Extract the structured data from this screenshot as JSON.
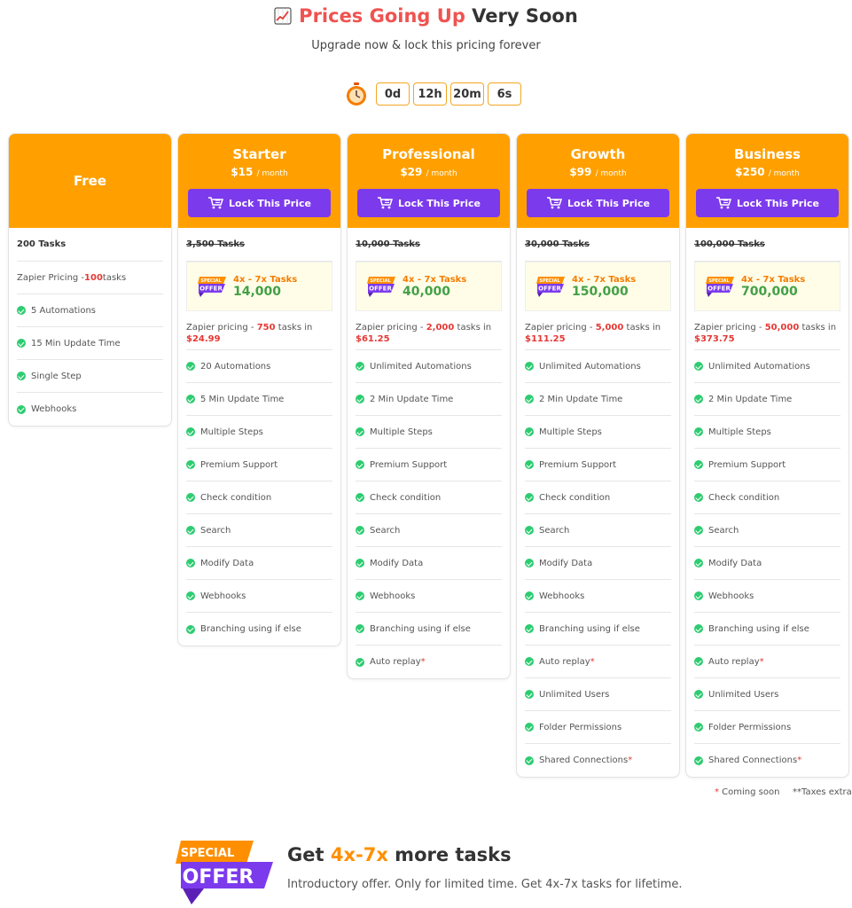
{
  "header": {
    "icon": "chart-increasing-icon",
    "title_accent": "Prices Going Up",
    "title_rest": "Very Soon",
    "subtitle": "Upgrade now & lock this pricing forever"
  },
  "countdown": {
    "icon": "stopwatch-icon",
    "days": "0d",
    "hours": "12h",
    "minutes": "20m",
    "seconds": "6s"
  },
  "colors": {
    "header_orange": "#ffa000",
    "button_purple": "#7c3aed",
    "accent_red": "#ef5350",
    "check_green": "#2ecc71",
    "offer_bg": "#fffde7"
  },
  "plans": {
    "free": {
      "name": "Free",
      "tasks": "200 Tasks",
      "zapier_pre": "Zapier Pricing -",
      "zapier_num": "100",
      "zapier_post": " tasks",
      "features": [
        "5 Automations",
        "15 Min Update Time",
        "Single Step",
        "Webhooks"
      ]
    },
    "starter": {
      "name": "Starter",
      "price": "$15",
      "period": "/ month",
      "button": "Lock This Price",
      "old_tasks": "3,500 Tasks",
      "offer_multi": "4x - 7x Tasks",
      "offer_tasks": "14,000",
      "zapier_pre": "Zapier pricing - ",
      "zapier_num": "750",
      "zapier_post": " tasks in",
      "zapier_price": "$24.99",
      "features": [
        "20 Automations",
        "5 Min Update Time",
        "Multiple Steps",
        "Premium Support",
        "Check condition",
        "Search",
        "Modify Data",
        "Webhooks",
        "Branching using if else"
      ]
    },
    "professional": {
      "name": "Professional",
      "price": "$29",
      "period": "/ month",
      "button": "Lock This Price",
      "old_tasks": "10,000 Tasks",
      "offer_multi": "4x - 7x Tasks",
      "offer_tasks": "40,000",
      "zapier_pre": "Zapier pricing - ",
      "zapier_num": "2,000",
      "zapier_post": " tasks in",
      "zapier_price": "$61.25",
      "features": [
        "Unlimited Automations",
        "2 Min Update Time",
        "Multiple Steps",
        "Premium Support",
        "Check condition",
        "Search",
        "Modify Data",
        "Webhooks",
        "Branching using if else",
        "Auto replay"
      ]
    },
    "growth": {
      "name": "Growth",
      "price": "$99",
      "period": "/ month",
      "button": "Lock This Price",
      "old_tasks": "30,000 Tasks",
      "offer_multi": "4x - 7x Tasks",
      "offer_tasks": "150,000",
      "zapier_pre": "Zapier pricing - ",
      "zapier_num": "5,000",
      "zapier_post": " tasks in",
      "zapier_price": "$111.25",
      "features": [
        "Unlimited Automations",
        "2 Min Update Time",
        "Multiple Steps",
        "Premium Support",
        "Check condition",
        "Search",
        "Modify Data",
        "Webhooks",
        "Branching using if else",
        "Auto replay",
        "Unlimited Users",
        "Folder Permissions",
        "Shared Connections"
      ]
    },
    "business": {
      "name": "Business",
      "price": "$250",
      "period": "/ month",
      "button": "Lock This Price",
      "old_tasks": "100,000 Tasks",
      "offer_multi": "4x - 7x Tasks",
      "offer_tasks": "700,000",
      "zapier_pre": "Zapier pricing - ",
      "zapier_num": "50,000",
      "zapier_post": " tasks in",
      "zapier_price": "$373.75",
      "features": [
        "Unlimited Automations",
        "2 Min Update Time",
        "Multiple Steps",
        "Premium Support",
        "Check condition",
        "Search",
        "Modify Data",
        "Webhooks",
        "Branching using if else",
        "Auto replay",
        "Unlimited Users",
        "Folder Permissions",
        "Shared Connections"
      ]
    }
  },
  "badge": {
    "special": "SPECIAL",
    "offer": "OFFER"
  },
  "footnotes": {
    "star": "*",
    "coming_soon": " Coming soon",
    "taxes": "**Taxes extra"
  },
  "promo": {
    "badge_special": "SPECIAL",
    "badge_offer": "OFFER",
    "title_pre": "Get ",
    "title_accent": "4x-7x",
    "title_post": " more tasks",
    "subtitle": "Introductory offer. Only for limited time. Get 4x-7x tasks for lifetime."
  }
}
